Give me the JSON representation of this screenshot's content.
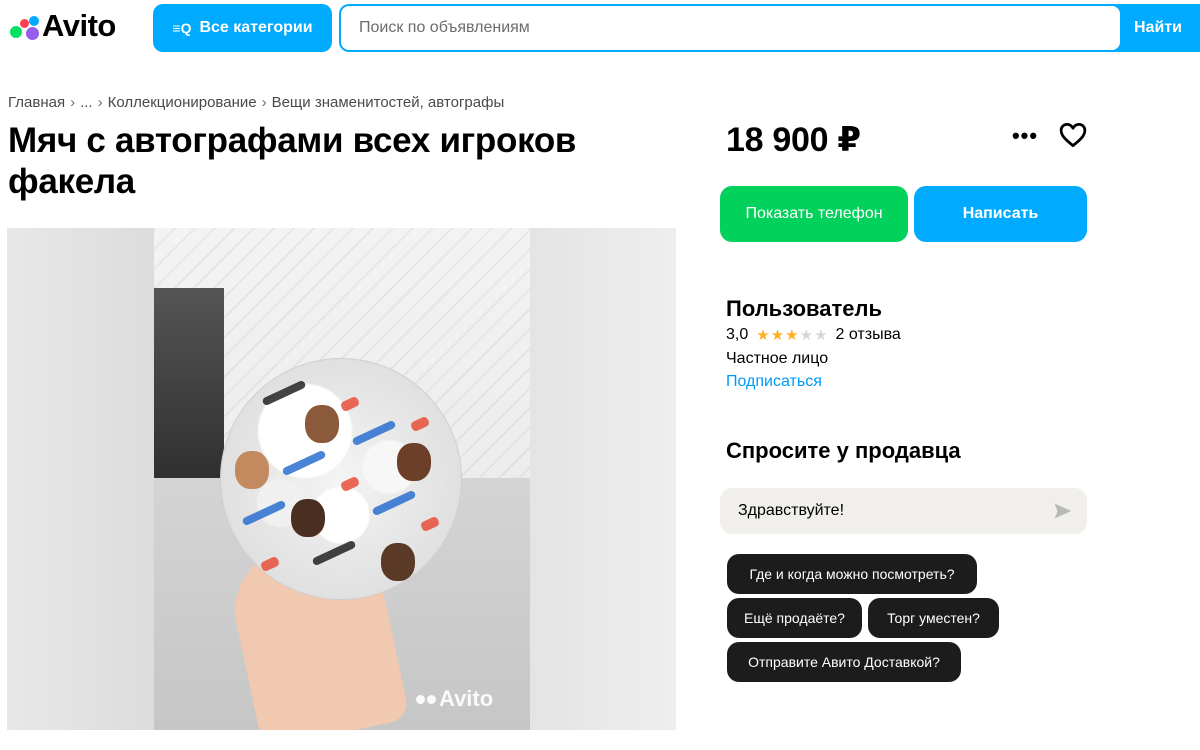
{
  "header": {
    "logo_text": "Avito",
    "categories_button": "Все категории",
    "search_placeholder": "Поиск по объявлениям",
    "search_button": "Найти"
  },
  "breadcrumb": [
    "Главная",
    "...",
    "Коллекционирование",
    "Вещи знаменитостей, автографы"
  ],
  "listing": {
    "title": "Мяч с автографами всех игроков факела",
    "price": "18 900 ₽",
    "photo_watermark": "Avito"
  },
  "actions": {
    "show_phone": "Показать телефон",
    "write": "Написать"
  },
  "seller": {
    "name": "Пользователь",
    "rating": "3,0",
    "rating_stars": 3,
    "rating_max": 5,
    "reviews": "2 отзыва",
    "type": "Частное лицо",
    "subscribe": "Подписаться"
  },
  "ask": {
    "title": "Спросите у продавца",
    "message_value": "Здравствуйте!",
    "quick_questions": [
      "Где и когда можно посмотреть?",
      "Ещё продаёте?",
      "Торг уместен?",
      "Отправите Авито Доставкой?"
    ]
  },
  "colors": {
    "brand_blue": "#00aaff",
    "phone_green": "#02d15c",
    "star": "#ffb021",
    "link": "#0099f7"
  }
}
